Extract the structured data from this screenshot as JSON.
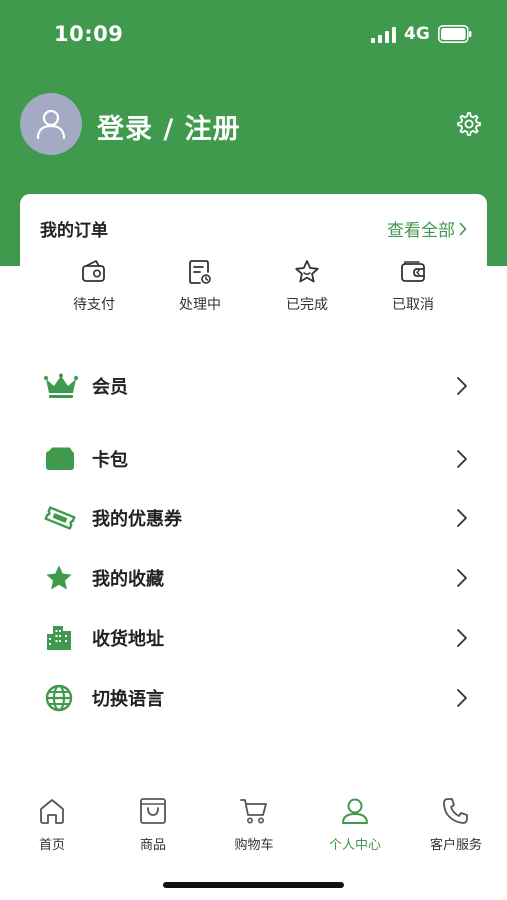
{
  "status_bar": {
    "time": "10:09",
    "network": "4G"
  },
  "profile": {
    "login_label": "登录 / 注册"
  },
  "orders": {
    "title": "我的订单",
    "view_all": "查看全部",
    "items": [
      {
        "label": "待支付",
        "icon": "wallet-pending-icon"
      },
      {
        "label": "处理中",
        "icon": "document-processing-icon"
      },
      {
        "label": "已完成",
        "icon": "star-outline-icon"
      },
      {
        "label": "已取消",
        "icon": "wallet-cancel-icon"
      }
    ]
  },
  "menu": {
    "items": [
      {
        "label": "会员",
        "icon": "crown-icon"
      },
      {
        "label": "卡包",
        "icon": "card-wallet-icon"
      },
      {
        "label": "我的优惠券",
        "icon": "ticket-icon"
      },
      {
        "label": "我的收藏",
        "icon": "star-icon"
      },
      {
        "label": "收货地址",
        "icon": "building-icon"
      },
      {
        "label": "切换语言",
        "icon": "globe-icon"
      }
    ]
  },
  "tabbar": {
    "items": [
      {
        "label": "首页",
        "icon": "home-icon"
      },
      {
        "label": "商品",
        "icon": "shopping-bag-icon"
      },
      {
        "label": "购物车",
        "icon": "cart-icon"
      },
      {
        "label": "个人中心",
        "icon": "user-icon"
      },
      {
        "label": "客户服务",
        "icon": "phone-icon"
      }
    ],
    "active": "个人中心"
  },
  "colors": {
    "brand": "#3f9a4d",
    "avatar": "#a4aac4"
  }
}
